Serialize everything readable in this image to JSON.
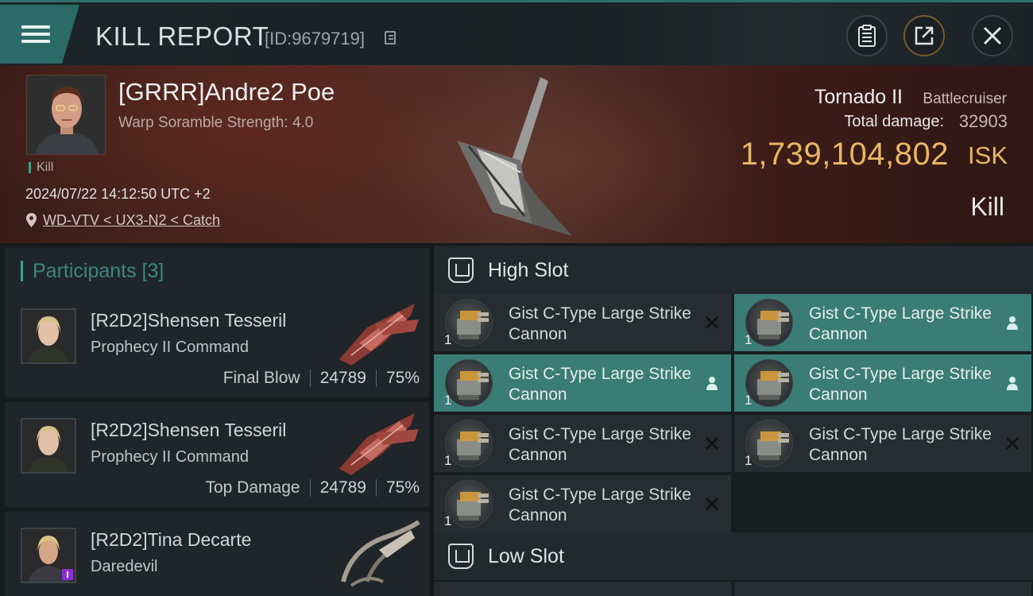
{
  "header": {
    "title": "KILL REPORT",
    "report_id": "[ID:9679719]"
  },
  "victim": {
    "name": "[GRRR]Andre2 Poe",
    "scramble": "Warp Soramble Strength: 4.0",
    "tag": "Kill",
    "datetime": "2024/07/22 14:12:50 UTC +2",
    "location": "WD-VTV < UX3-N2 < Catch",
    "ship_name": "Tornado II",
    "ship_class": "Battlecruiser",
    "damage_label": "Total damage:",
    "damage_value": "32903",
    "isk_value": "1,739,104,802",
    "isk_unit": "ISK",
    "result": "Kill"
  },
  "participants": {
    "label": "Participants [3]",
    "items": [
      {
        "name": "[R2D2]Shensen Tesseril",
        "ship": "Prophecy II Command",
        "role": "Final Blow",
        "damage": "24789",
        "percent": "75%"
      },
      {
        "name": "[R2D2]Shensen Tesseril",
        "ship": "Prophecy II Command",
        "role": "Top Damage",
        "damage": "24789",
        "percent": "75%"
      },
      {
        "name": "[R2D2]Tina Decarte",
        "ship": "Daredevil"
      }
    ]
  },
  "high_slot": {
    "label": "High Slot",
    "modules": [
      {
        "name": "Gist C-Type Large Strike Cannon",
        "qty": "1",
        "status": "destroyed"
      },
      {
        "name": "Gist C-Type Large Strike Cannon",
        "qty": "1",
        "status": "dropped"
      },
      {
        "name": "Gist C-Type Large Strike Cannon",
        "qty": "1",
        "status": "dropped"
      },
      {
        "name": "Gist C-Type Large Strike Cannon",
        "qty": "1",
        "status": "dropped"
      },
      {
        "name": "Gist C-Type Large Strike Cannon",
        "qty": "1",
        "status": "destroyed"
      },
      {
        "name": "Gist C-Type Large Strike Cannon",
        "qty": "1",
        "status": "destroyed"
      },
      {
        "name": "Gist C-Type Large Strike Cannon",
        "qty": "1",
        "status": "destroyed"
      }
    ]
  },
  "low_slot": {
    "label": "Low Slot"
  },
  "colors": {
    "accent": "#3a7c76",
    "isk": "#e8b763",
    "banner": "#4e2620"
  }
}
